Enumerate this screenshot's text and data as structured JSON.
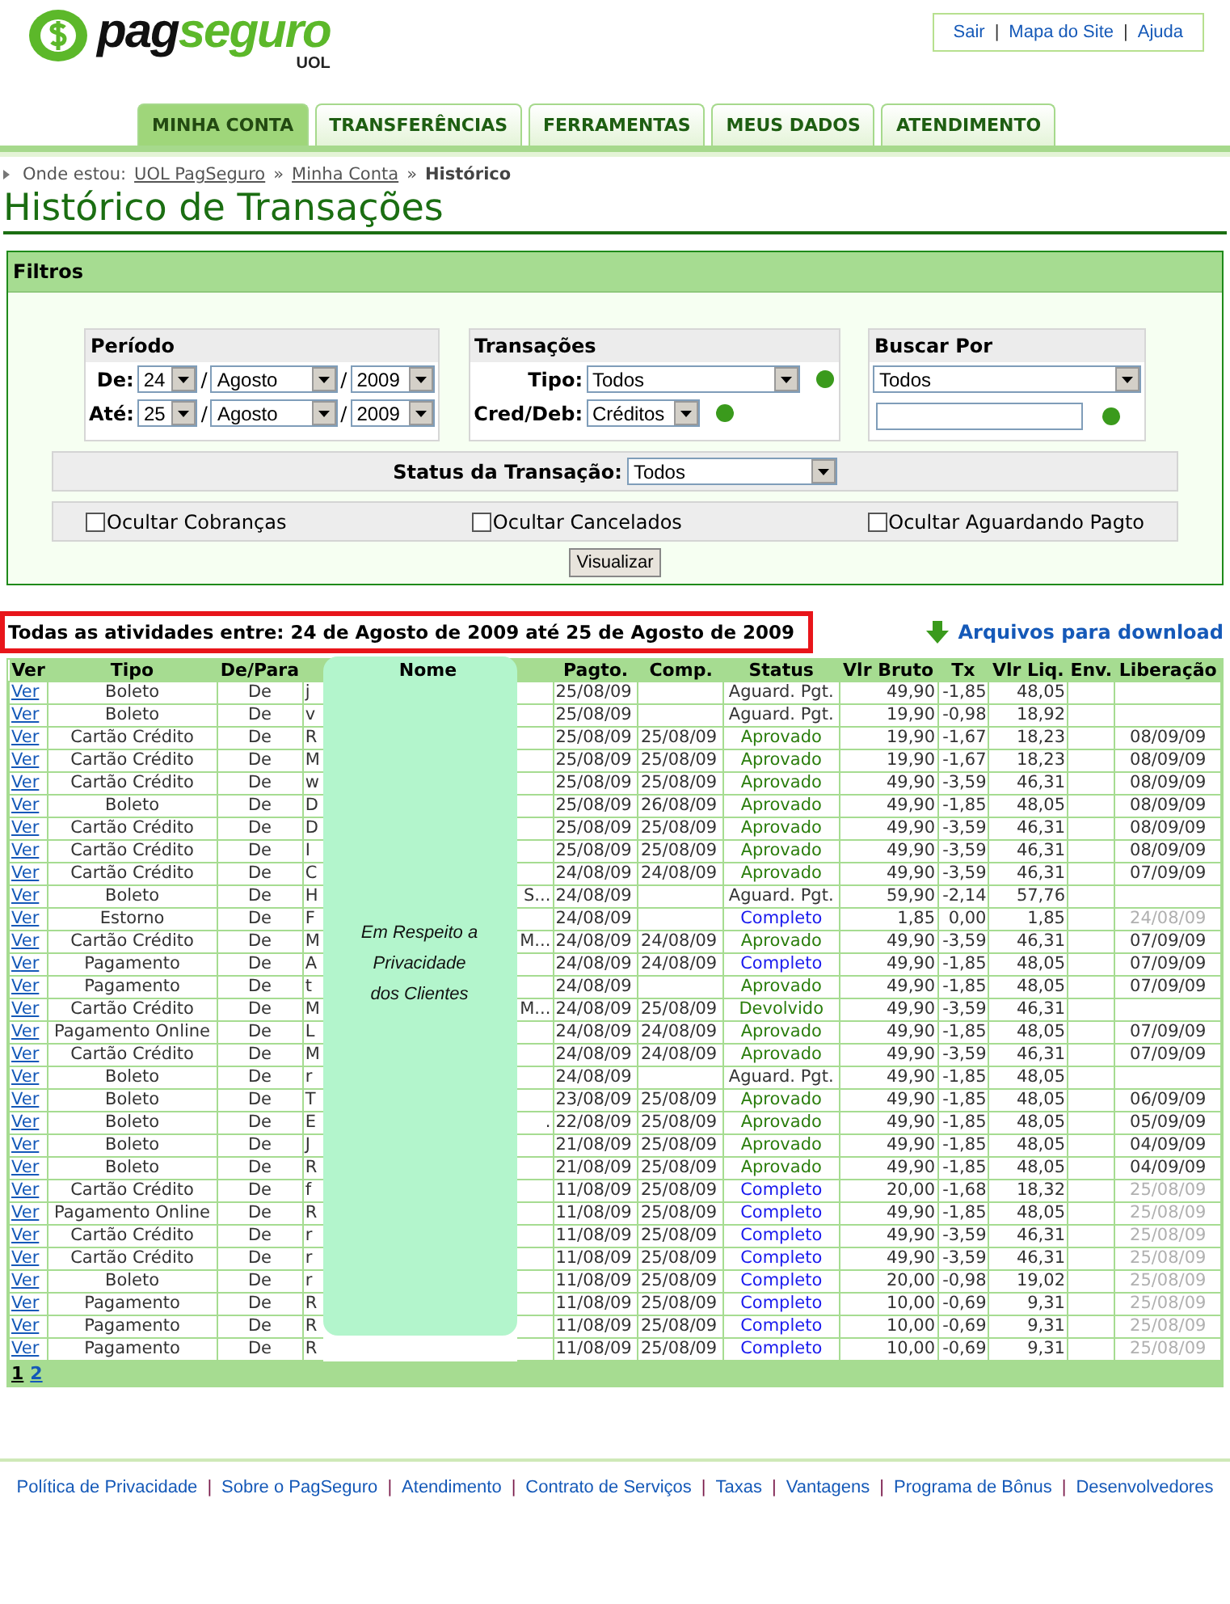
{
  "logo": {
    "name_a": "pag",
    "name_b": "seguro",
    "sub": "UOL"
  },
  "top_links": [
    "Sair",
    "Mapa do Site",
    "Ajuda"
  ],
  "top_links_separator": "|",
  "date_separator": "/",
  "footer_separator": "|",
  "tabs": [
    {
      "label": "MINHA CONTA",
      "selected": true
    },
    {
      "label": "TRANSFERÊNCIAS",
      "selected": false
    },
    {
      "label": "FERRAMENTAS",
      "selected": false
    },
    {
      "label": "MEUS DADOS",
      "selected": false
    },
    {
      "label": "ATENDIMENTO",
      "selected": false
    }
  ],
  "breadcrumb": {
    "prefix": "Onde estou:",
    "separator": "»",
    "links": [
      "UOL PagSeguro",
      "Minha Conta"
    ],
    "current": "Histórico"
  },
  "page_title": "Histórico de Transações",
  "filters": {
    "title": "Filtros",
    "periodo": {
      "title": "Período",
      "rows": [
        {
          "label": "De:",
          "day": "24",
          "month": "Agosto",
          "year": "2009"
        },
        {
          "label": "Até:",
          "day": "25",
          "month": "Agosto",
          "year": "2009"
        }
      ]
    },
    "transacoes": {
      "title": "Transações",
      "rows": [
        {
          "label": "Tipo:",
          "value": "Todos"
        },
        {
          "label": "Cred/Deb:",
          "value": "Créditos"
        }
      ]
    },
    "buscar": {
      "title": "Buscar Por",
      "value": "Todos"
    },
    "status": {
      "label": "Status da Transação:",
      "value": "Todos"
    },
    "checkboxes": [
      {
        "label": "Ocultar Cobranças",
        "checked": false
      },
      {
        "label": "Ocultar Cancelados",
        "checked": false
      },
      {
        "label": "Ocultar Aguardando Pagto",
        "checked": false
      }
    ],
    "button": "Visualizar"
  },
  "summary": "Todas as atividades entre: 24 de Agosto de 2009 até 25 de Agosto de 2009",
  "download_link": "Arquivos para download",
  "table": {
    "columns": [
      "Ver",
      "Tipo",
      "De/Para",
      "Nome",
      "Pagto.",
      "Comp.",
      "Status",
      "Vlr Bruto",
      "Tx",
      "Vlr Liq.",
      "Env.",
      "Liberação"
    ],
    "privacy_note": [
      "Em Respeito a",
      "Privacidade",
      "dos Clientes"
    ],
    "rows": [
      {
        "ver": "Ver",
        "tipo": "Boleto",
        "de_para": "De",
        "nome": "j",
        "nome_end": "",
        "pagto": "25/08/09",
        "comp": "",
        "status": "Aguard. Pgt.",
        "color": "#333333",
        "bruto": "49,90",
        "tx": "-1,85",
        "liq": "48,05",
        "liberacao": ""
      },
      {
        "ver": "Ver",
        "tipo": "Boleto",
        "de_para": "De",
        "nome": "v",
        "nome_end": "",
        "pagto": "25/08/09",
        "comp": "",
        "status": "Aguard. Pgt.",
        "color": "#333333",
        "bruto": "19,90",
        "tx": "-0,98",
        "liq": "18,92",
        "liberacao": ""
      },
      {
        "ver": "Ver",
        "tipo": "Cartão Crédito",
        "de_para": "De",
        "nome": "R",
        "nome_end": "",
        "pagto": "25/08/09",
        "comp": "25/08/09",
        "status": "Aprovado",
        "color": "#2a7d0c",
        "bruto": "19,90",
        "tx": "-1,67",
        "liq": "18,23",
        "liberacao": "08/09/09",
        "released": false
      },
      {
        "ver": "Ver",
        "tipo": "Cartão Crédito",
        "de_para": "De",
        "nome": "M",
        "nome_end": "",
        "pagto": "25/08/09",
        "comp": "25/08/09",
        "status": "Aprovado",
        "color": "#2a7d0c",
        "bruto": "19,90",
        "tx": "-1,67",
        "liq": "18,23",
        "liberacao": "08/09/09",
        "released": false
      },
      {
        "ver": "Ver",
        "tipo": "Cartão Crédito",
        "de_para": "De",
        "nome": "w",
        "nome_end": "",
        "pagto": "25/08/09",
        "comp": "25/08/09",
        "status": "Aprovado",
        "color": "#2a7d0c",
        "bruto": "49,90",
        "tx": "-3,59",
        "liq": "46,31",
        "liberacao": "08/09/09",
        "released": false
      },
      {
        "ver": "Ver",
        "tipo": "Boleto",
        "de_para": "De",
        "nome": "D",
        "nome_end": "",
        "pagto": "25/08/09",
        "comp": "26/08/09",
        "status": "Aprovado",
        "color": "#2a7d0c",
        "bruto": "49,90",
        "tx": "-1,85",
        "liq": "48,05",
        "liberacao": "08/09/09",
        "released": false
      },
      {
        "ver": "Ver",
        "tipo": "Cartão Crédito",
        "de_para": "De",
        "nome": "D",
        "nome_end": "",
        "pagto": "25/08/09",
        "comp": "25/08/09",
        "status": "Aprovado",
        "color": "#2a7d0c",
        "bruto": "49,90",
        "tx": "-3,59",
        "liq": "46,31",
        "liberacao": "08/09/09",
        "released": false
      },
      {
        "ver": "Ver",
        "tipo": "Cartão Crédito",
        "de_para": "De",
        "nome": "I",
        "nome_end": "",
        "pagto": "25/08/09",
        "comp": "25/08/09",
        "status": "Aprovado",
        "color": "#2a7d0c",
        "bruto": "49,90",
        "tx": "-3,59",
        "liq": "46,31",
        "liberacao": "08/09/09",
        "released": false
      },
      {
        "ver": "Ver",
        "tipo": "Cartão Crédito",
        "de_para": "De",
        "nome": "C",
        "nome_end": "",
        "pagto": "24/08/09",
        "comp": "24/08/09",
        "status": "Aprovado",
        "color": "#2a7d0c",
        "bruto": "49,90",
        "tx": "-3,59",
        "liq": "46,31",
        "liberacao": "07/09/09",
        "released": false
      },
      {
        "ver": "Ver",
        "tipo": "Boleto",
        "de_para": "De",
        "nome": "H",
        "nome_end": "S...",
        "pagto": "24/08/09",
        "comp": "",
        "status": "Aguard. Pgt.",
        "color": "#333333",
        "bruto": "59,90",
        "tx": "-2,14",
        "liq": "57,76",
        "liberacao": ""
      },
      {
        "ver": "Ver",
        "tipo": "Estorno",
        "de_para": "De",
        "nome": "F",
        "nome_end": "",
        "pagto": "24/08/09",
        "comp": "",
        "status": "Completo",
        "color": "#1a1aee",
        "bruto": "1,85",
        "tx": "0,00",
        "liq": "1,85",
        "liberacao": "24/08/09",
        "released": true
      },
      {
        "ver": "Ver",
        "tipo": "Cartão Crédito",
        "de_para": "De",
        "nome": "M",
        "nome_end": "M...",
        "pagto": "24/08/09",
        "comp": "24/08/09",
        "status": "Aprovado",
        "color": "#2a7d0c",
        "bruto": "49,90",
        "tx": "-3,59",
        "liq": "46,31",
        "liberacao": "07/09/09",
        "released": false
      },
      {
        "ver": "Ver",
        "tipo": "Pagamento",
        "de_para": "De",
        "nome": "A",
        "nome_end": "",
        "pagto": "24/08/09",
        "comp": "24/08/09",
        "status": "Completo",
        "color": "#1a1aee",
        "bruto": "49,90",
        "tx": "-1,85",
        "liq": "48,05",
        "liberacao": "07/09/09",
        "released": false
      },
      {
        "ver": "Ver",
        "tipo": "Pagamento",
        "de_para": "De",
        "nome": "t",
        "nome_end": "",
        "pagto": "24/08/09",
        "comp": "",
        "status": "Aprovado",
        "color": "#2a7d0c",
        "bruto": "49,90",
        "tx": "-1,85",
        "liq": "48,05",
        "liberacao": "07/09/09",
        "released": false
      },
      {
        "ver": "Ver",
        "tipo": "Cartão Crédito",
        "de_para": "De",
        "nome": "M",
        "nome_end": "M...",
        "pagto": "24/08/09",
        "comp": "25/08/09",
        "status": "Devolvido",
        "color": "#2a7d0c",
        "bruto": "49,90",
        "tx": "-3,59",
        "liq": "46,31",
        "liberacao": ""
      },
      {
        "ver": "Ver",
        "tipo": "Pagamento Online",
        "de_para": "De",
        "nome": "L",
        "nome_end": "",
        "pagto": "24/08/09",
        "comp": "24/08/09",
        "status": "Aprovado",
        "color": "#2a7d0c",
        "bruto": "49,90",
        "tx": "-1,85",
        "liq": "48,05",
        "liberacao": "07/09/09",
        "released": false
      },
      {
        "ver": "Ver",
        "tipo": "Cartão Crédito",
        "de_para": "De",
        "nome": "M",
        "nome_end": "",
        "pagto": "24/08/09",
        "comp": "24/08/09",
        "status": "Aprovado",
        "color": "#2a7d0c",
        "bruto": "49,90",
        "tx": "-3,59",
        "liq": "46,31",
        "liberacao": "07/09/09",
        "released": false
      },
      {
        "ver": "Ver",
        "tipo": "Boleto",
        "de_para": "De",
        "nome": "r",
        "nome_end": "",
        "pagto": "24/08/09",
        "comp": "",
        "status": "Aguard. Pgt.",
        "color": "#333333",
        "bruto": "49,90",
        "tx": "-1,85",
        "liq": "48,05",
        "liberacao": ""
      },
      {
        "ver": "Ver",
        "tipo": "Boleto",
        "de_para": "De",
        "nome": "T",
        "nome_end": "",
        "pagto": "23/08/09",
        "comp": "25/08/09",
        "status": "Aprovado",
        "color": "#2a7d0c",
        "bruto": "49,90",
        "tx": "-1,85",
        "liq": "48,05",
        "liberacao": "06/09/09",
        "released": false
      },
      {
        "ver": "Ver",
        "tipo": "Boleto",
        "de_para": "De",
        "nome": "E",
        "nome_end": ".",
        "pagto": "22/08/09",
        "comp": "25/08/09",
        "status": "Aprovado",
        "color": "#2a7d0c",
        "bruto": "49,90",
        "tx": "-1,85",
        "liq": "48,05",
        "liberacao": "05/09/09",
        "released": false
      },
      {
        "ver": "Ver",
        "tipo": "Boleto",
        "de_para": "De",
        "nome": "J",
        "nome_end": "",
        "pagto": "21/08/09",
        "comp": "25/08/09",
        "status": "Aprovado",
        "color": "#2a7d0c",
        "bruto": "49,90",
        "tx": "-1,85",
        "liq": "48,05",
        "liberacao": "04/09/09",
        "released": false
      },
      {
        "ver": "Ver",
        "tipo": "Boleto",
        "de_para": "De",
        "nome": "R",
        "nome_end": "",
        "pagto": "21/08/09",
        "comp": "25/08/09",
        "status": "Aprovado",
        "color": "#2a7d0c",
        "bruto": "49,90",
        "tx": "-1,85",
        "liq": "48,05",
        "liberacao": "04/09/09",
        "released": false
      },
      {
        "ver": "Ver",
        "tipo": "Cartão Crédito",
        "de_para": "De",
        "nome": "f",
        "nome_end": "",
        "pagto": "11/08/09",
        "comp": "25/08/09",
        "status": "Completo",
        "color": "#1a1aee",
        "bruto": "20,00",
        "tx": "-1,68",
        "liq": "18,32",
        "liberacao": "25/08/09",
        "released": true
      },
      {
        "ver": "Ver",
        "tipo": "Pagamento Online",
        "de_para": "De",
        "nome": "R",
        "nome_end": "",
        "pagto": "11/08/09",
        "comp": "25/08/09",
        "status": "Completo",
        "color": "#1a1aee",
        "bruto": "49,90",
        "tx": "-1,85",
        "liq": "48,05",
        "liberacao": "25/08/09",
        "released": true
      },
      {
        "ver": "Ver",
        "tipo": "Cartão Crédito",
        "de_para": "De",
        "nome": "r",
        "nome_end": "",
        "pagto": "11/08/09",
        "comp": "25/08/09",
        "status": "Completo",
        "color": "#1a1aee",
        "bruto": "49,90",
        "tx": "-3,59",
        "liq": "46,31",
        "liberacao": "25/08/09",
        "released": true
      },
      {
        "ver": "Ver",
        "tipo": "Cartão Crédito",
        "de_para": "De",
        "nome": "r",
        "nome_end": "",
        "pagto": "11/08/09",
        "comp": "25/08/09",
        "status": "Completo",
        "color": "#1a1aee",
        "bruto": "49,90",
        "tx": "-3,59",
        "liq": "46,31",
        "liberacao": "25/08/09",
        "released": true
      },
      {
        "ver": "Ver",
        "tipo": "Boleto",
        "de_para": "De",
        "nome": "r",
        "nome_end": "",
        "pagto": "11/08/09",
        "comp": "25/08/09",
        "status": "Completo",
        "color": "#1a1aee",
        "bruto": "20,00",
        "tx": "-0,98",
        "liq": "19,02",
        "liberacao": "25/08/09",
        "released": true
      },
      {
        "ver": "Ver",
        "tipo": "Pagamento",
        "de_para": "De",
        "nome": "R",
        "nome_end": "",
        "pagto": "11/08/09",
        "comp": "25/08/09",
        "status": "Completo",
        "color": "#1a1aee",
        "bruto": "10,00",
        "tx": "-0,69",
        "liq": "9,31",
        "liberacao": "25/08/09",
        "released": true
      },
      {
        "ver": "Ver",
        "tipo": "Pagamento",
        "de_para": "De",
        "nome": "R",
        "nome_end": "",
        "pagto": "11/08/09",
        "comp": "25/08/09",
        "status": "Completo",
        "color": "#1a1aee",
        "bruto": "10,00",
        "tx": "-0,69",
        "liq": "9,31",
        "liberacao": "25/08/09",
        "released": true
      },
      {
        "ver": "Ver",
        "tipo": "Pagamento",
        "de_para": "De",
        "nome": "R",
        "nome_end": "",
        "pagto": "11/08/09",
        "comp": "25/08/09",
        "status": "Completo",
        "color": "#1a1aee",
        "bruto": "10,00",
        "tx": "-0,69",
        "liq": "9,31",
        "liberacao": "25/08/09",
        "released": true
      }
    ]
  },
  "pagination": [
    {
      "label": "1",
      "selected": true
    },
    {
      "label": "2",
      "selected": false
    }
  ],
  "footer_links": [
    "Política de Privacidade",
    "Sobre o PagSeguro",
    "Atendimento",
    "Contrato de Serviços",
    "Taxas",
    "Vantagens",
    "Programa de Bônus",
    "Desenvolvedores"
  ]
}
